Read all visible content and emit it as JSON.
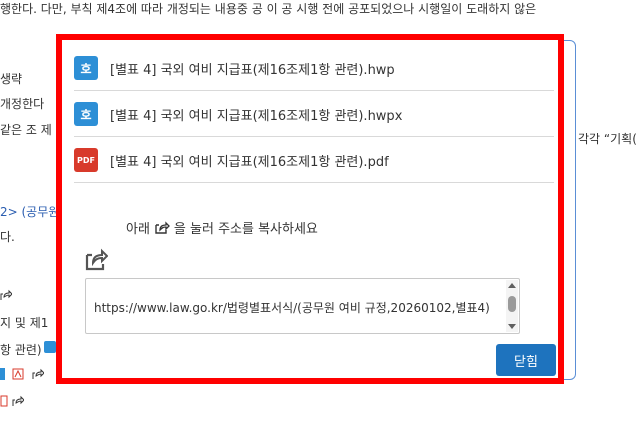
{
  "background": {
    "top_line": "행한다. 다만, 부칙 제4조에 따라 개정되는 내용중 공 이 공 시행 전에 공포되었으나 시행일이 도래하지 않은",
    "lines": [
      "생략",
      "개정한다",
      "같은 조 제",
      "각각 “기획(",
      "2> (공무원",
      "다.",
      "지 및 제1",
      "항 관련)"
    ]
  },
  "popup": {
    "files": [
      {
        "icon": "hwp-icon",
        "icon_text": "호",
        "label": "[별표 4] 국외 여비 지급표(제16조제1항 관련).hwp"
      },
      {
        "icon": "hwp-icon",
        "icon_text": "호",
        "label": "[별표 4] 국외 여비 지급표(제16조제1항 관련).hwpx"
      },
      {
        "icon": "pdf-icon",
        "icon_text": "PDF",
        "label": "[별표 4] 국외 여비 지급표(제16조제1항 관련).pdf"
      }
    ],
    "copy_instruction_before": "아래",
    "copy_instruction_after": "을 눌러 주소를 복사하세요",
    "url": "https://www.law.go.kr/법령별표서식/(공무원 여비 규정,20260102,별표4)",
    "close_label": "닫힘"
  },
  "colors": {
    "highlight_border": "#ff0000",
    "close_button": "#1e73be",
    "hwp_icon": "#2d8fd6",
    "pdf_icon": "#d83a2b"
  }
}
